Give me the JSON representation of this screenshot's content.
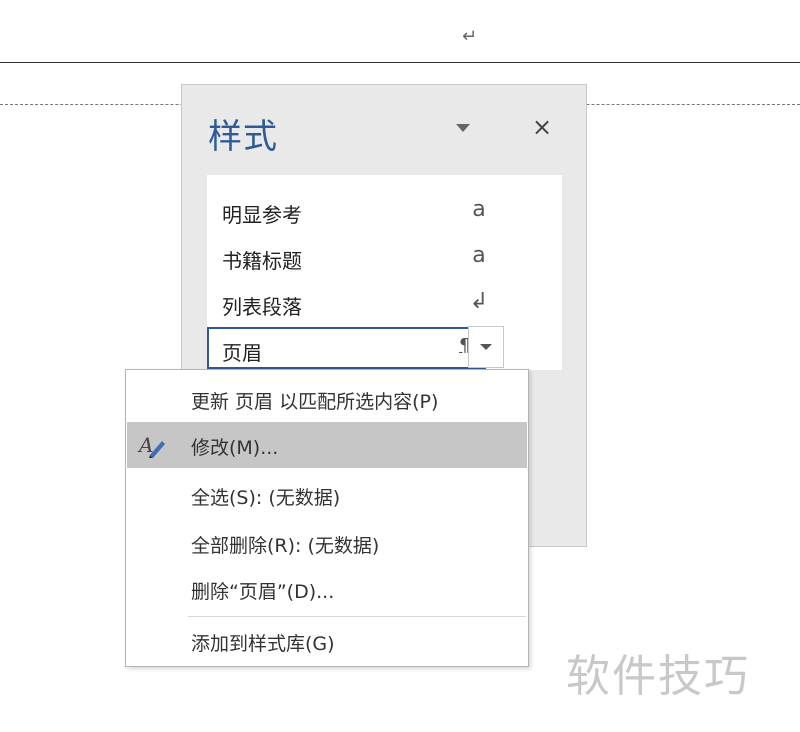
{
  "document": {
    "paragraph_mark": "↵"
  },
  "styles_pane": {
    "title": "样式",
    "close_glyph": "×",
    "items": [
      {
        "label": "明显参考",
        "glyph": "a"
      },
      {
        "label": "书籍标题",
        "glyph": "a"
      },
      {
        "label": "列表段落",
        "glyph": "↲"
      },
      {
        "label": "页眉",
        "glyph": "¶a"
      }
    ]
  },
  "context_menu": {
    "items": [
      {
        "label": "更新 页眉 以匹配所选内容(P)"
      },
      {
        "label": "修改(M)...",
        "icon": "pen-edit-icon"
      },
      {
        "label": "全选(S): (无数据)"
      },
      {
        "label": "全部删除(R): (无数据)"
      },
      {
        "label": "删除“页眉”(D)..."
      },
      {
        "label": "添加到样式库(G)"
      }
    ]
  },
  "watermark": "软件技巧",
  "colors": {
    "accent": "#2e5b95",
    "pane_bg": "#e9e9ea",
    "highlight": "#c6c6c6"
  }
}
